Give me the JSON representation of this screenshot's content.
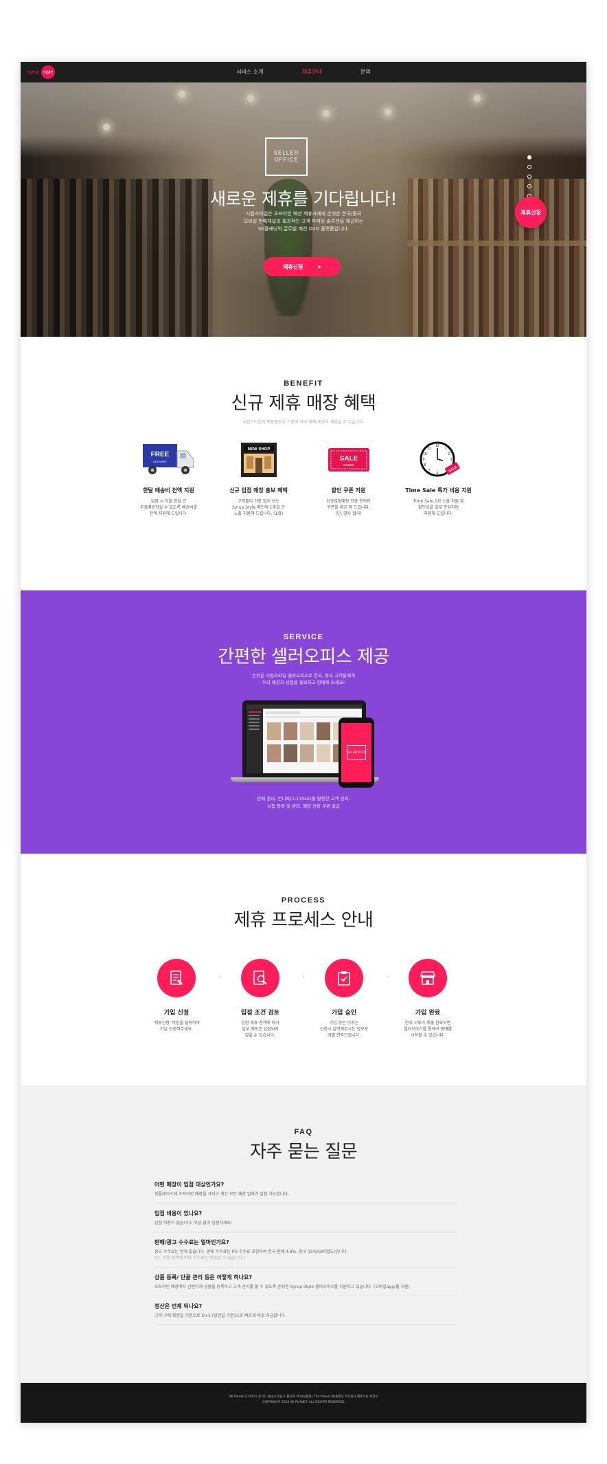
{
  "header": {
    "logo_syrup": "syrup",
    "logo_style": "style",
    "nav": [
      "서비스 소개",
      "제휴안내",
      "문의"
    ],
    "active_index": 1
  },
  "hero": {
    "logo_line1": "SELLER",
    "logo_line2": "OFFICE",
    "title": "새로운 제휴를 기다립니다!",
    "desc_line1": "시럽스타일은 오프라인 패션 제휴사에게 손쉬운 한국/중국",
    "desc_line2": "모바일 판매채널과 효과적인 고객 마케팅 솔루션을 제공하는",
    "desc_line3": "SK플래닛의 글로벌 패션 O2O 플랫폼입니다.",
    "cta": "제휴신청",
    "float_button": "제휴신청",
    "slide_count": 5,
    "active_slide": 0
  },
  "benefit": {
    "eyebrow": "BENEFIT",
    "heading": "신규 제휴 매장 혜택",
    "sub": "시럽스타일의 매장활동성 기준에 따라 혜택 제공이 제한될 수 있습니다.",
    "items": [
      {
        "icon_text": "FREE",
        "icon_sub": "DELIVERY",
        "title": "한달 배송비 전액 지원",
        "desc1": "입점 시 익월 한달 간",
        "desc2": "무료배송하실 수 있도록 배송비를",
        "desc3": "전액 지원해 드립니다."
      },
      {
        "icon_text": "NEW SHOP",
        "icon_sub": "",
        "title": "신규 입점 매장 홍보 혜택",
        "desc1": "고객들이 가장 많이 보는",
        "desc2": "Syrup Style 메인에 1주일 간",
        "desc3": "노출 지원해 드립니다. (1회)"
      },
      {
        "icon_text": "SALE",
        "icon_sub": "coupon",
        "title": "할인 쿠폰 지원",
        "desc1": "신규입점매장 전용 온라인",
        "desc2": "쿠폰을 제공 해 드립니다.",
        "desc3": "(단, 명사 협의)"
      },
      {
        "icon_text": "SALE",
        "icon_sub": "",
        "title": "Time Sale 특가 비용 지원",
        "desc1": "Time Sale 1회 노출 지원 및",
        "desc2": "할인금을 일부 분담하여",
        "desc3": "지원해 드립니다."
      }
    ]
  },
  "service": {
    "eyebrow": "SERVICE",
    "heading": "간편한 셀러오피스 제공",
    "sub1": "손쉬운 시럽스타일 셀러오피스로 한국, 중국 고객들에게",
    "sub2": "우리 매장과 상품을 홍보하고 판매해 보세요!",
    "phone_line1": "SELLER",
    "phone_line2": "OFFICE",
    "desc1": "판매 관리, 언니톡(1:1TALK)을 활용한 고객 관리,",
    "desc2": "상품 등록 및 관리, 매장 전용 쿠폰 발급"
  },
  "process": {
    "eyebrow": "PROCESS",
    "heading": "제휴 프로세스 안내",
    "steps": [
      {
        "icon": "document-icon",
        "title": "가입 신청",
        "desc1": "'제휴신청' 버튼을 클릭하여",
        "desc2": "가입 신청해주세요.",
        "desc3": ""
      },
      {
        "icon": "search-doc-icon",
        "title": "입점 조건 검토",
        "desc1": "입점 제휴 정책에 따라",
        "desc2": "일부 매장은 입점되지",
        "desc3": "않을 수 있습니다."
      },
      {
        "icon": "clipboard-check-icon",
        "title": "가입 승인",
        "desc1": "가입 승인 이후는",
        "desc2": "신청시 입력해주시는 정보로",
        "desc3": "개별 연락드립니다."
      },
      {
        "icon": "store-icon",
        "title": "가입 완료",
        "desc1": "안내 서류가 제출 완료되면",
        "desc2": "셀러오피스를 통하여 판매를",
        "desc3": "시작할 수 있습니다."
      }
    ]
  },
  "faq": {
    "eyebrow": "FAQ",
    "heading": "자주 묻는 질문",
    "items": [
      {
        "q": "어떤 매장이 입점 대상인가요?",
        "a": "핫플레이스에 오프라인 매장을 가지고 계신 모든 패션 업체가 입점 가능합니다.",
        "note": ""
      },
      {
        "q": "입점 비용이 있나요?",
        "a": "입점 비용이 없습니다. 부담 없이 입점하세요!",
        "note": ""
      },
      {
        "q": "판매/광고 수수료는 얼마인가요?",
        "a": "광고 수수료는 현재 없습니다. 판매 수수료는 PG 수수료 포함하여 한국 판매 4.8%, 중국 15%(VAT별도)입니다.",
        "note": "(단, 이용 정책에 따라 수수료는 변경될 수 있습니다.)"
      },
      {
        "q": "상품 등록/ 단골 관리 등은 어떻게 하나요?",
        "a": "오프라인 매장에서 간편하게 상품을 등록하고 고객 관리를 할 수 있도록 손쉬운 Syrup Style 셀러오피스를 지원하고 있습니다. (모바일app/웹 지원)",
        "note": ""
      },
      {
        "q": "정산은 언제 되나요?",
        "a": "고객 구매 확정일 기준으로 D+5 (영업일 기준)으로 빠르게 바로 지급합니다.",
        "note": ""
      }
    ]
  },
  "footer": {
    "line1": "SK Planet (13487) 경기도 성남시 분당구 판교로 264(삼평동) The Planet  SK플래닛 주식회사 대표이사 서진우",
    "line2": "COPYRIGHT 2016 SK PLANET. ALL RIGHTS RESERVED"
  },
  "colors": {
    "accent": "#ff1e5a",
    "purple": "#8846d8",
    "dark": "#1e1e1e",
    "faq_bg": "#f1f1f1"
  }
}
